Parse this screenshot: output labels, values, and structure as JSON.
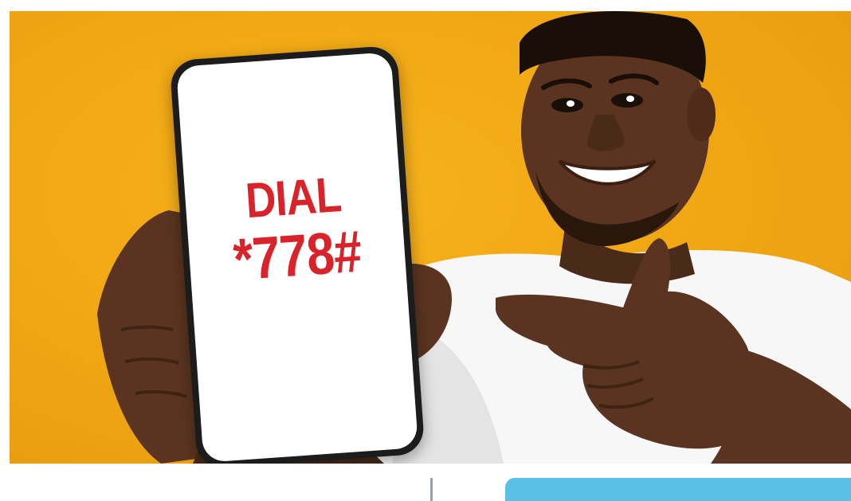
{
  "phone_screen": {
    "line1": "DIAL",
    "line2": "*778#"
  },
  "colors": {
    "background_orange": "#f0a613",
    "dial_red": "#d8232a",
    "shirt_white": "#f7f7f7",
    "skin_dark": "#5a3420",
    "tab_blue": "#5cbfe6"
  }
}
